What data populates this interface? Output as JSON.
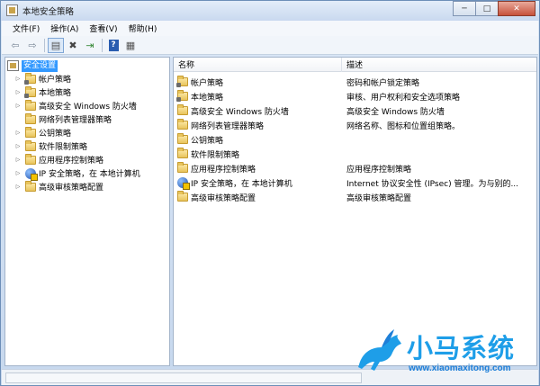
{
  "window": {
    "title": "本地安全策略"
  },
  "window_controls": {
    "minimize": "─",
    "maximize": "□",
    "close": "✕"
  },
  "menu": [
    {
      "label": "文件(F)"
    },
    {
      "label": "操作(A)"
    },
    {
      "label": "查看(V)"
    },
    {
      "label": "帮助(H)"
    }
  ],
  "toolbar": [
    {
      "icon": "back-arrow-icon",
      "glyph": "⇦"
    },
    {
      "icon": "forward-arrow-icon",
      "glyph": "⇨"
    },
    {
      "icon": "show-hide-tree-icon",
      "glyph": "▤"
    },
    {
      "icon": "delete-icon",
      "glyph": "✖"
    },
    {
      "icon": "export-list-icon",
      "glyph": "⇥"
    },
    {
      "icon": "help-icon",
      "glyph": "?"
    },
    {
      "icon": "properties-icon",
      "glyph": "▦"
    }
  ],
  "tree": {
    "root": {
      "label": "安全设置"
    },
    "items": [
      {
        "label": "帐户策略",
        "icon": "lock-folder-icon",
        "expandable": true
      },
      {
        "label": "本地策略",
        "icon": "lock-folder-icon",
        "expandable": true
      },
      {
        "label": "高级安全 Windows 防火墙",
        "icon": "folder-icon",
        "expandable": true
      },
      {
        "label": "网络列表管理器策略",
        "icon": "folder-icon",
        "expandable": false
      },
      {
        "label": "公钥策略",
        "icon": "folder-icon",
        "expandable": true
      },
      {
        "label": "软件限制策略",
        "icon": "folder-icon",
        "expandable": true
      },
      {
        "label": "应用程序控制策略",
        "icon": "folder-icon",
        "expandable": true
      },
      {
        "label": "IP 安全策略，在 本地计算机",
        "icon": "ipsec-icon",
        "expandable": true
      },
      {
        "label": "高级审核策略配置",
        "icon": "folder-icon",
        "expandable": true
      }
    ]
  },
  "list": {
    "columns": {
      "name": "名称",
      "description": "描述"
    },
    "rows": [
      {
        "name": "帐户策略",
        "description": "密码和帐户锁定策略",
        "icon": "lock-folder-icon"
      },
      {
        "name": "本地策略",
        "description": "审核、用户权利和安全选项策略",
        "icon": "lock-folder-icon"
      },
      {
        "name": "高级安全 Windows 防火墙",
        "description": "高级安全 Windows 防火墙",
        "icon": "folder-icon"
      },
      {
        "name": "网络列表管理器策略",
        "description": "网络名称、图标和位置组策略。",
        "icon": "folder-icon"
      },
      {
        "name": "公钥策略",
        "description": "",
        "icon": "folder-icon"
      },
      {
        "name": "软件限制策略",
        "description": "",
        "icon": "folder-icon"
      },
      {
        "name": "应用程序控制策略",
        "description": "应用程序控制策略",
        "icon": "folder-icon"
      },
      {
        "name": "IP 安全策略，在 本地计算机",
        "description": "Internet 协议安全性 (IPsec) 管理。为与别的...",
        "icon": "ipsec-icon"
      },
      {
        "name": "高级审核策略配置",
        "description": "高级审核策略配置",
        "icon": "folder-icon"
      }
    ]
  },
  "watermark": {
    "title": "小马系统",
    "url": "www.xiaomaxitong.com"
  },
  "colors": {
    "selection": "#3399ff",
    "watermark": "#1e9ee8",
    "close": "#c7513b"
  }
}
